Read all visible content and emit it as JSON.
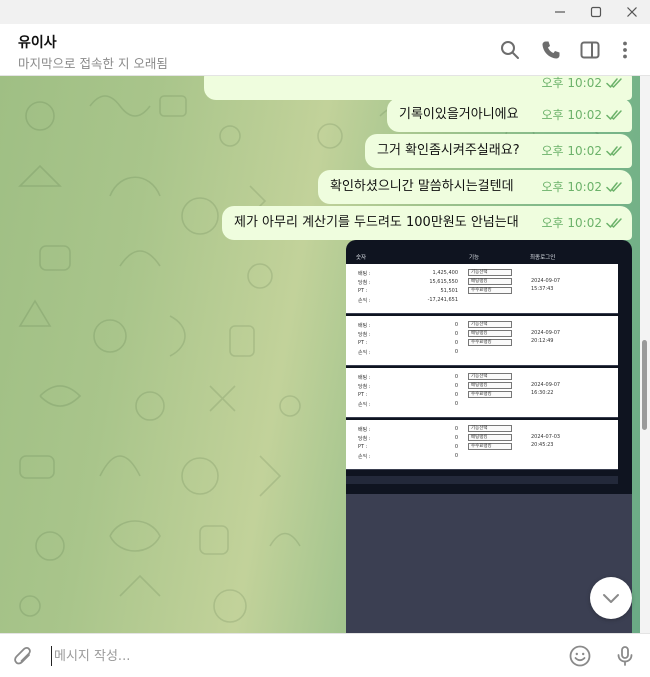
{
  "window": {
    "minimize_icon": "minimize-icon",
    "maximize_icon": "maximize-icon",
    "close_icon": "close-icon"
  },
  "header": {
    "title": "유이사",
    "status": "마지막으로 접속한 지 오래됨",
    "icons": [
      "search-icon",
      "phone-icon",
      "sidebar-toggle-icon",
      "more-vertical-icon"
    ]
  },
  "colors": {
    "bubble": "#effdde",
    "accent_green": "#6cb26a",
    "chat_bg_start": "#9fbf84",
    "chat_bg_end": "#6aa985"
  },
  "messages": [
    {
      "text": "",
      "time": "오후 10:02",
      "status": "read"
    },
    {
      "text": "기록이있을거아니에요",
      "time": "오후 10:02",
      "status": "read"
    },
    {
      "text": "그거 확인좀시켜주실래요?",
      "time": "오후 10:02",
      "status": "read"
    },
    {
      "text": "확인하셨으니간 말씀하시는걸텐데",
      "time": "오후 10:02",
      "status": "read"
    },
    {
      "text": "제가 아무리 계산기를 두드려도 100만원도 안넘는대",
      "time": "오후 10:02",
      "status": "read"
    }
  ],
  "screenshot_table": {
    "headers": [
      "숫자",
      "기능",
      "최종로그인"
    ],
    "row_labels": [
      "배팅 :",
      "당첨 :",
      "PT :",
      "손익 :"
    ],
    "selects": [
      "기능선택",
      "배팅랭킹",
      "수수료랭킹"
    ],
    "rows": [
      {
        "values": [
          "1,425,400",
          "15,615,550",
          "51,501",
          "-17,241,651"
        ],
        "date": "2024-09-07",
        "time": "15:37:43"
      },
      {
        "values": [
          "0",
          "0",
          "0",
          "0"
        ],
        "date": "2024-09-07",
        "time": "20:12:49"
      },
      {
        "values": [
          "0",
          "0",
          "0",
          "0"
        ],
        "date": "2024-09-07",
        "time": "16:30:22"
      },
      {
        "values": [
          "0",
          "0",
          "0",
          "0"
        ],
        "date": "2024-07-03",
        "time": "20:45:23"
      }
    ]
  },
  "composer": {
    "placeholder": "메시지 작성...",
    "attach_icon": "paperclip-icon",
    "emoji_icon": "emoji-icon",
    "mic_icon": "microphone-icon"
  }
}
